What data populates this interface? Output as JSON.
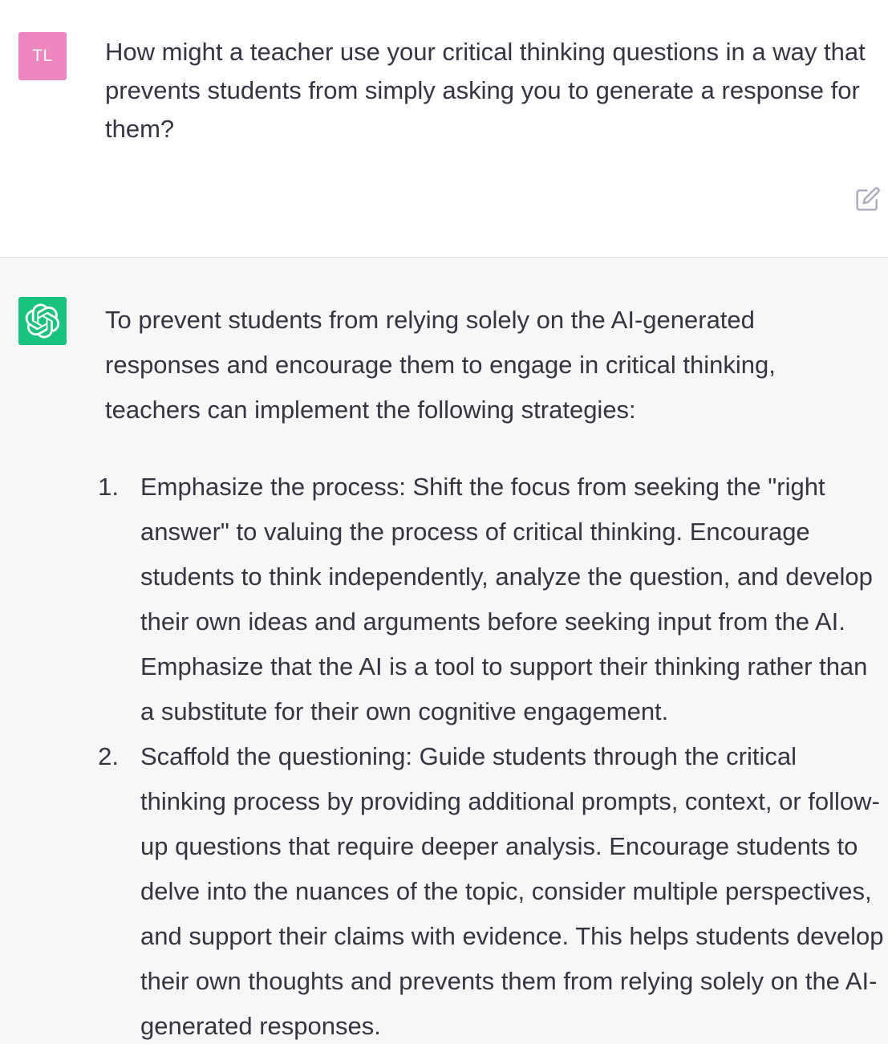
{
  "user": {
    "avatar_initials": "TL",
    "avatar_color": "#ee87c0",
    "message": "How might a teacher use your critical thinking questions in a way that prevents students from simply asking you to generate a response for them?",
    "edit_icon": "edit-icon"
  },
  "assistant": {
    "avatar_icon": "openai-logo-icon",
    "avatar_color": "#19c37d",
    "intro": "To prevent students from relying solely on the AI-generated responses and encourage them to engage in critical thinking, teachers can implement the following strategies:",
    "items": [
      {
        "number": "1.",
        "text": "Emphasize the process: Shift the focus from seeking the \"right answer\" to valuing the process of critical thinking. Encourage students to think independently, analyze the question, and develop their own ideas and arguments before seeking input from the AI. Emphasize that the AI is a tool to support their thinking rather than a substitute for their own cognitive engagement."
      },
      {
        "number": "2.",
        "text": "Scaffold the questioning: Guide students through the critical thinking process by providing additional prompts, context, or follow-up questions that require deeper analysis. Encourage students to delve into the nuances of the topic, consider multiple perspectives, and support their claims with evidence. This helps students develop their own thoughts and prevents them from relying solely on the AI-generated responses."
      }
    ]
  }
}
